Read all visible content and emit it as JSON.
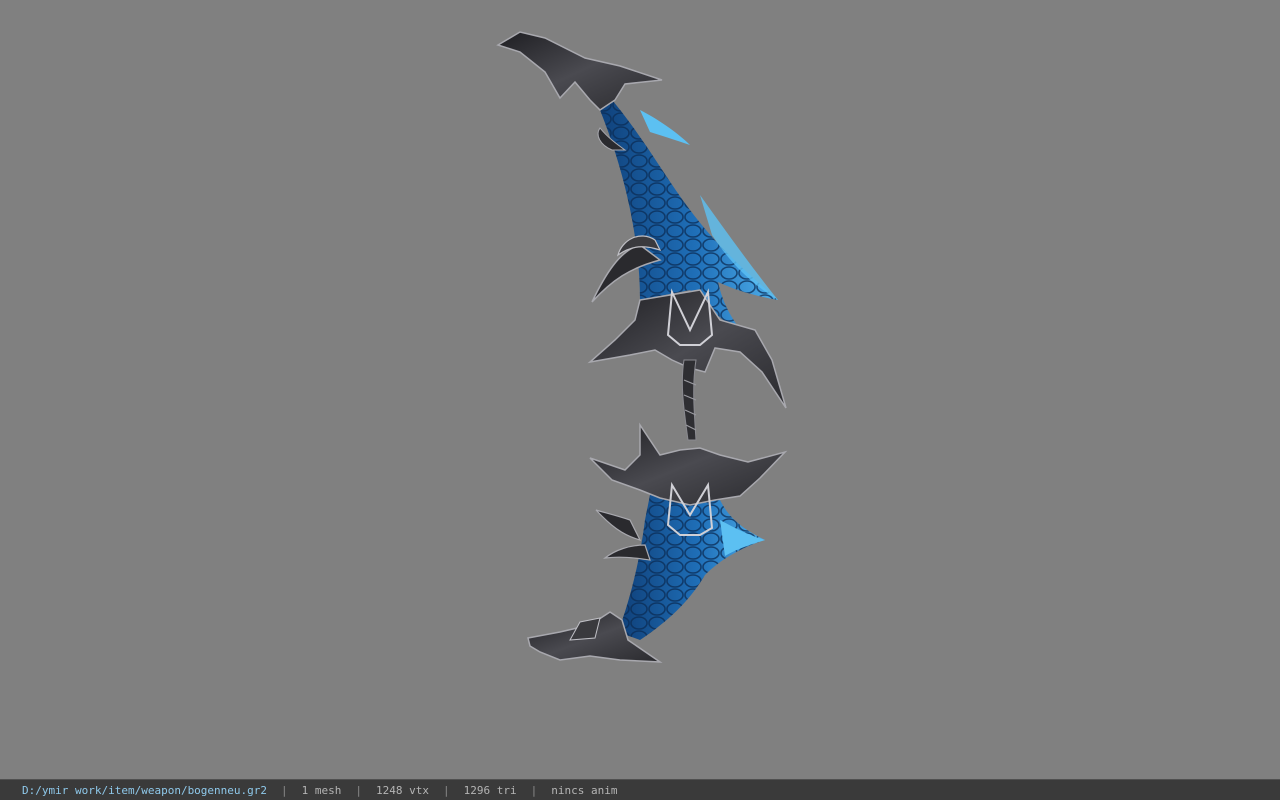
{
  "viewer": {
    "background_color": "#808080",
    "model_icon": "bow-model",
    "model_colors": {
      "blade": "#1f6fb8",
      "blade_highlight": "#4fb0ec",
      "metal": "#3c3c40",
      "metal_highlight": "#a8a8ae"
    }
  },
  "status": {
    "path": "D:/ymir work/item/weapon/bogenneu.gr2",
    "separator": "|",
    "mesh": "1 mesh",
    "vertices": "1248 vtx",
    "triangles": "1296 tri",
    "anim": "nincs anim"
  }
}
